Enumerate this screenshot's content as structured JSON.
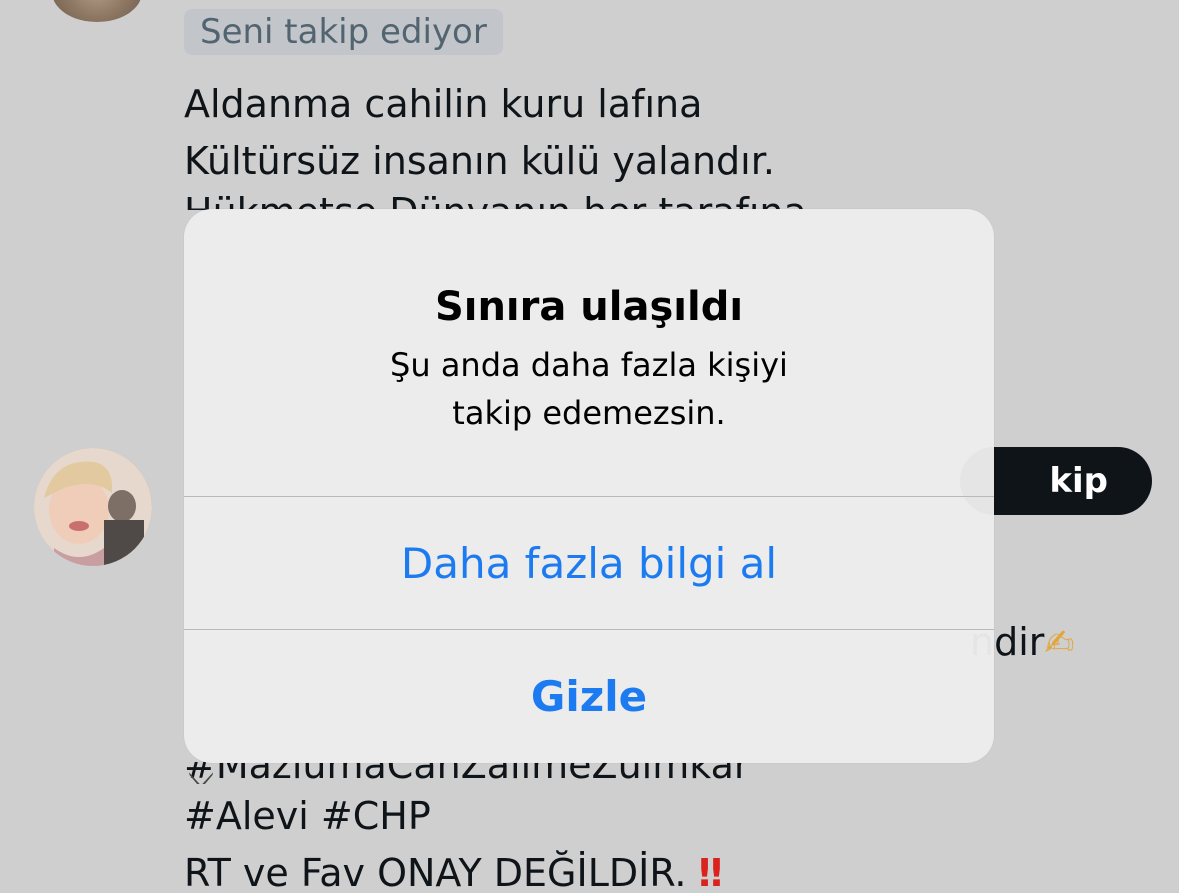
{
  "background_profile": {
    "follows_you_badge": "Seni takip ediyor",
    "bio_lines": [
      "Aldanma cahilin kuru lafına",
      "Kültürsüz insanın külü yalandır."
    ],
    "bio_cut_line": "Hükmetse Dünyanın her tarafına"
  },
  "second_profile": {
    "follow_button_label": "kip",
    "bio_fragment": "ndir",
    "hashtag_cut_line": "#MazlumaCanZalimeZulmkar",
    "bio_lines": [
      "#Alevi #CHP",
      "RT ve Fav ONAY DEĞİLDİR."
    ],
    "exclamation": "‼"
  },
  "alert": {
    "title": "Sınıra ulaşıldı",
    "message_lines": [
      "Şu anda daha fazla kişiyi",
      "takip edemezsin."
    ],
    "button_more_info": "Daha fazla bilgi al",
    "button_dismiss": "Gizle",
    "button_color": "#1c7bf0"
  },
  "icons": {
    "writing_hand": "writing-hand-icon",
    "crossed_swords": "crossed-swords-icon",
    "double_exclamation": "double-exclamation-icon"
  }
}
